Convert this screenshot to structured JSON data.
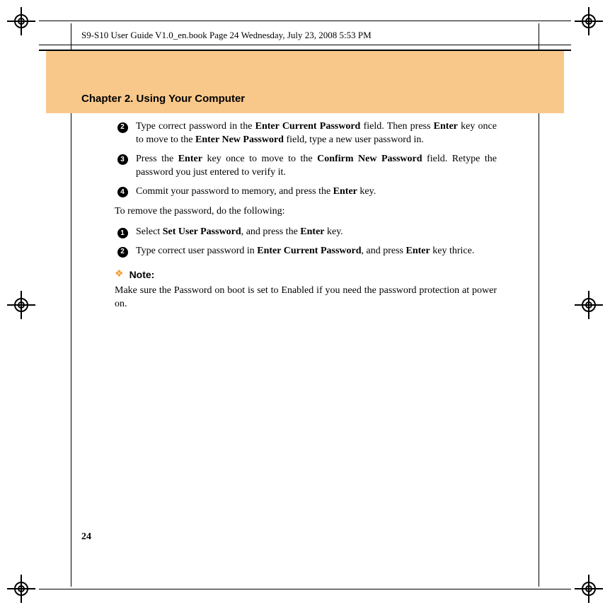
{
  "header": "S9-S10 User Guide V1.0_en.book  Page 24  Wednesday, July 23, 2008  5:53 PM",
  "chapter_title": "Chapter 2. Using Your Computer",
  "steps_a": [
    {
      "num": "2",
      "pre": "Type correct password in the ",
      "b1": "Enter Current Password",
      "mid1": " field. Then press ",
      "b2": "Enter",
      "mid2": " key once to move to the ",
      "b3": "Enter New Password",
      "post": " field, type a new user password in."
    },
    {
      "num": "3",
      "pre": "Press the ",
      "b1": "Enter",
      "mid1": " key once to move to the ",
      "b2": "Confirm New Password",
      "mid2": "",
      "b3": "",
      "post": " field. Retype the password you just entered to verify it."
    },
    {
      "num": "4",
      "pre": "Commit your password to memory, and press the ",
      "b1": "Enter",
      "mid1": " key.",
      "b2": "",
      "mid2": "",
      "b3": "",
      "post": ""
    }
  ],
  "para_remove": "To remove the password, do the following:",
  "steps_b": [
    {
      "num": "1",
      "pre": "Select ",
      "b1": "Set User Password",
      "mid1": ", and press the ",
      "b2": "Enter",
      "mid2": " key.",
      "b3": "",
      "post": ""
    },
    {
      "num": "2",
      "pre": "Type correct user password in ",
      "b1": "Enter Current Password",
      "mid1": ", and press ",
      "b2": "Enter",
      "mid2": " key thrice.",
      "b3": "",
      "post": ""
    }
  ],
  "note": {
    "label": "Note:",
    "pre": "Make sure the ",
    "b1": "Password on boot",
    "mid": " is set to ",
    "b2": "Enabled",
    "post": " if you need the password protection at power on."
  },
  "page_number": "24"
}
